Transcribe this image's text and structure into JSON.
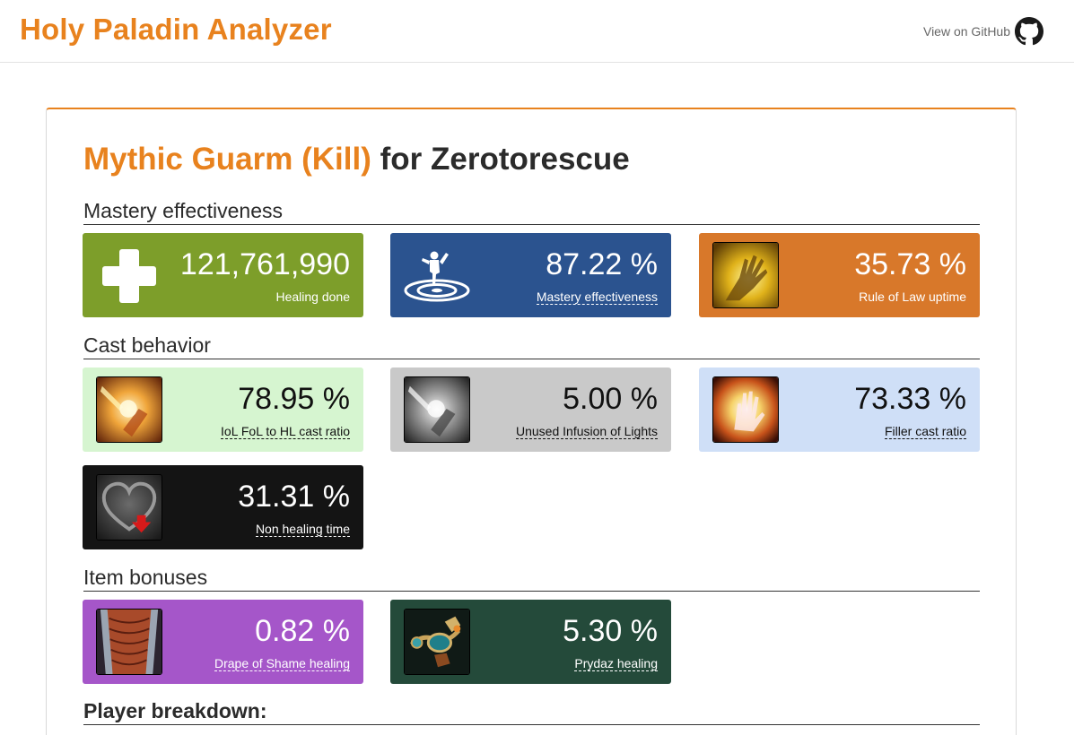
{
  "app": {
    "title": "Holy Paladin Analyzer",
    "github_label": "View on GitHub"
  },
  "report": {
    "fight": "Mythic Guarm (Kill)",
    "player_prefix": "for",
    "player": "Zerotorescue"
  },
  "sections": {
    "mastery": "Mastery effectiveness",
    "cast": "Cast behavior",
    "items": "Item bonuses",
    "players": "Player breakdown:"
  },
  "tiles": {
    "healing_done": {
      "value": "121,761,990",
      "label": "Healing done",
      "color": "#7d9e2a",
      "icon": "plus-icon"
    },
    "mastery_eff": {
      "value": "87.22 %",
      "label": "Mastery effectiveness",
      "color": "#2b538f",
      "icon": "mastery-icon"
    },
    "rule_of_law": {
      "value": "35.73 %",
      "label": "Rule of Law uptime",
      "color": "#d8782a",
      "icon": "rule-of-law-icon"
    },
    "iol_ratio": {
      "value": "78.95 %",
      "label": "IoL FoL to HL cast ratio",
      "color": "#d6f5d0",
      "icon": "infusion-of-light-icon"
    },
    "unused_iol": {
      "value": "5.00 %",
      "label": "Unused Infusion of Lights",
      "color": "#c9c9c9",
      "icon": "infusion-of-light-grey-icon"
    },
    "filler_ratio": {
      "value": "73.33 %",
      "label": "Filler cast ratio",
      "color": "#cfdff7",
      "icon": "holy-light-icon"
    },
    "non_healing": {
      "value": "31.31 %",
      "label": "Non healing time",
      "color": "#141414",
      "icon": "broken-heart-icon"
    },
    "drape": {
      "value": "0.82 %",
      "label": "Drape of Shame healing",
      "color": "#a556c9",
      "icon": "drape-of-shame-icon"
    },
    "prydaz": {
      "value": "5.30 %",
      "label": "Prydaz healing",
      "color": "#244a3a",
      "icon": "prydaz-icon"
    }
  }
}
